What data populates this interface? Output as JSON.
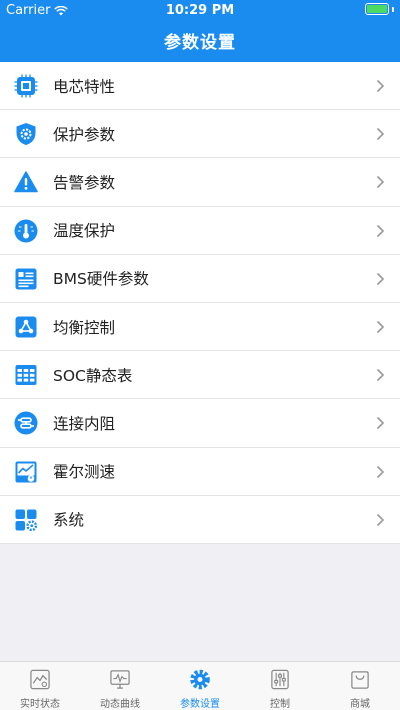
{
  "status_bar": {
    "carrier": "Carrier",
    "time": "10:29 PM"
  },
  "header": {
    "title": "参数设置"
  },
  "colors": {
    "primary": "#1a8cf0",
    "inactive": "#888888"
  },
  "menu": [
    {
      "label": "电芯特性",
      "icon": "chip-icon"
    },
    {
      "label": "保护参数",
      "icon": "shield-gear-icon"
    },
    {
      "label": "告警参数",
      "icon": "warning-icon"
    },
    {
      "label": "温度保护",
      "icon": "thermometer-icon"
    },
    {
      "label": "BMS硬件参数",
      "icon": "document-list-icon"
    },
    {
      "label": "均衡控制",
      "icon": "network-icon"
    },
    {
      "label": "SOC静态表",
      "icon": "table-grid-icon"
    },
    {
      "label": "连接内阻",
      "icon": "resistor-icon"
    },
    {
      "label": "霍尔测速",
      "icon": "speed-chart-icon"
    },
    {
      "label": "系统",
      "icon": "system-grid-icon"
    }
  ],
  "tabbar": {
    "items": [
      {
        "label": "实时状态",
        "icon": "realtime-chart-icon",
        "active": false
      },
      {
        "label": "动态曲线",
        "icon": "curve-monitor-icon",
        "active": false
      },
      {
        "label": "参数设置",
        "icon": "gear-icon",
        "active": true
      },
      {
        "label": "控制",
        "icon": "sliders-icon",
        "active": false
      },
      {
        "label": "商城",
        "icon": "shopping-bag-icon",
        "active": false
      }
    ]
  }
}
